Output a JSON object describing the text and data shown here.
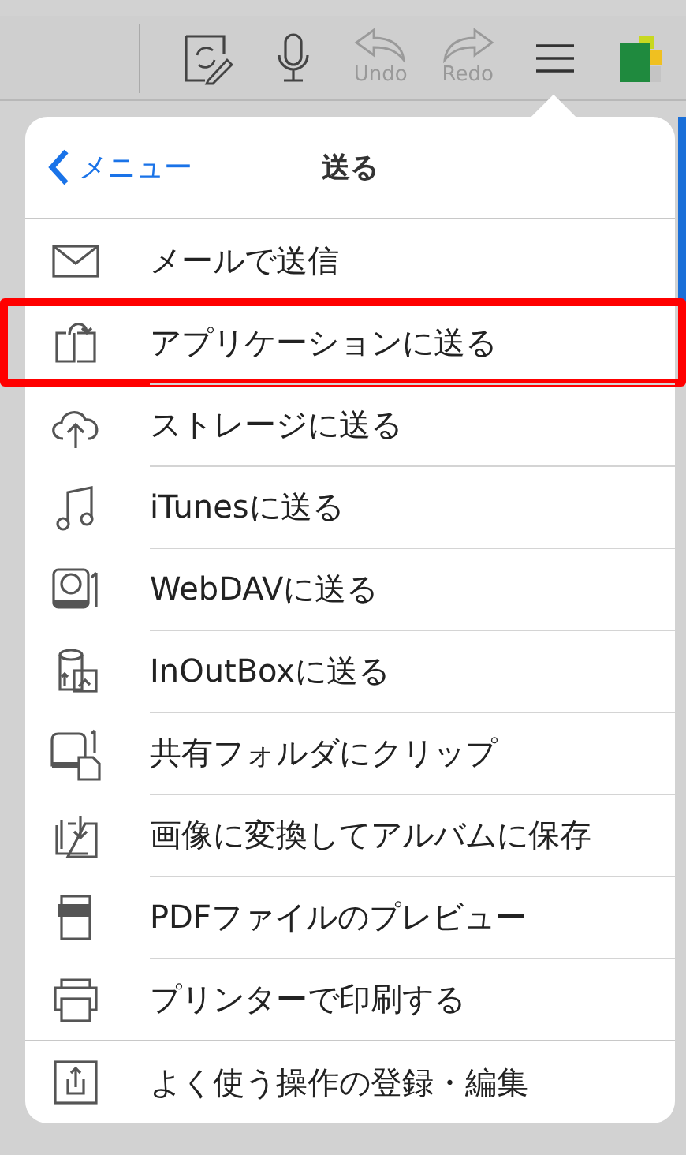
{
  "toolbar": {
    "tools": [
      {
        "kind": "sync-edit"
      },
      {
        "kind": "mic"
      },
      {
        "kind": "undo",
        "label": "Undo",
        "disabled": true
      },
      {
        "kind": "redo",
        "label": "Redo",
        "disabled": true
      },
      {
        "kind": "menu"
      },
      {
        "kind": "logo"
      }
    ]
  },
  "popover": {
    "back": "メニュー",
    "title": "送る",
    "sections": [
      [
        {
          "label": "メールで送信",
          "kind": "mail",
          "highlighted": false
        },
        {
          "label": "アプリケーションに送る",
          "kind": "app",
          "highlighted": true
        },
        {
          "label": "ストレージに送る",
          "kind": "cloud",
          "highlighted": false
        },
        {
          "label": "iTunesに送る",
          "kind": "music",
          "highlighted": false
        },
        {
          "label": "WebDAVに送る",
          "kind": "webdav",
          "highlighted": false
        },
        {
          "label": "InOutBoxに送る",
          "kind": "inoutbox",
          "highlighted": false
        },
        {
          "label": "共有フォルダにクリップ",
          "kind": "folder",
          "highlighted": false
        },
        {
          "label": "画像に変換してアルバムに保存",
          "kind": "images",
          "highlighted": false
        },
        {
          "label": "PDFファイルのプレビュー",
          "kind": "pdf",
          "highlighted": false
        },
        {
          "label": "プリンターで印刷する",
          "kind": "printer",
          "highlighted": false
        }
      ],
      [
        {
          "label": "よく使う操作の登録・編集",
          "kind": "share",
          "highlighted": false
        }
      ]
    ]
  }
}
